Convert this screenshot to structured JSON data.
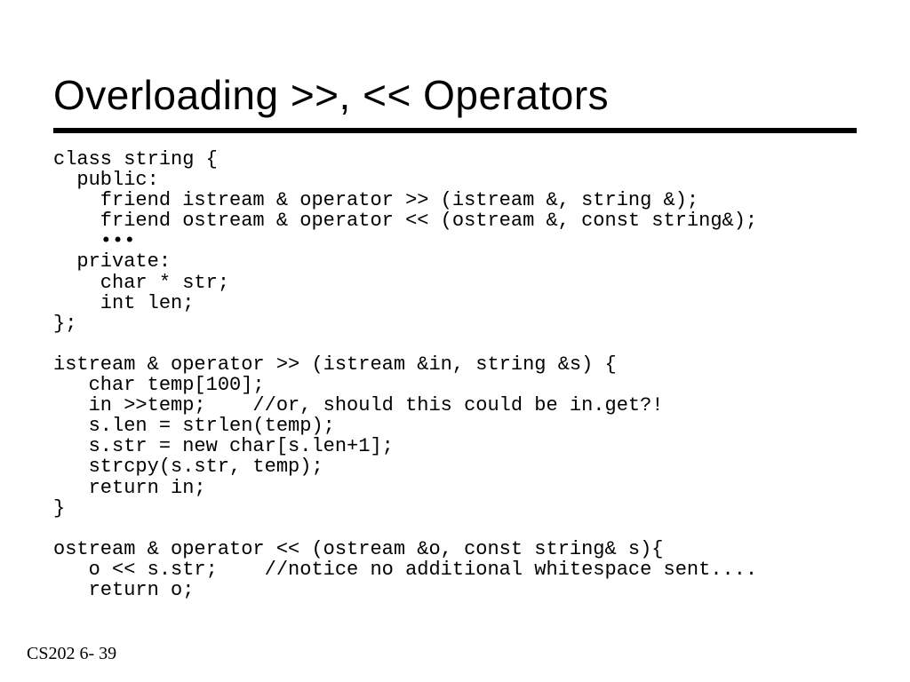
{
  "title": "Overloading >>, << Operators",
  "code": "class string {\n  public:\n    friend istream & operator >> (istream &, string &);\n    friend ostream & operator << (ostream &, const string&);\n    •••\n  private:\n    char * str;\n    int len;\n};\n\nistream & operator >> (istream &in, string &s) {\n   char temp[100];\n   in >>temp;    //or, should this could be in.get?!\n   s.len = strlen(temp);\n   s.str = new char[s.len+1];\n   strcpy(s.str, temp);\n   return in;\n}\n\nostream & operator << (ostream &o, const string& s){\n   o << s.str;    //notice no additional whitespace sent....\n   return o;",
  "footer": "CS202 6- 39"
}
